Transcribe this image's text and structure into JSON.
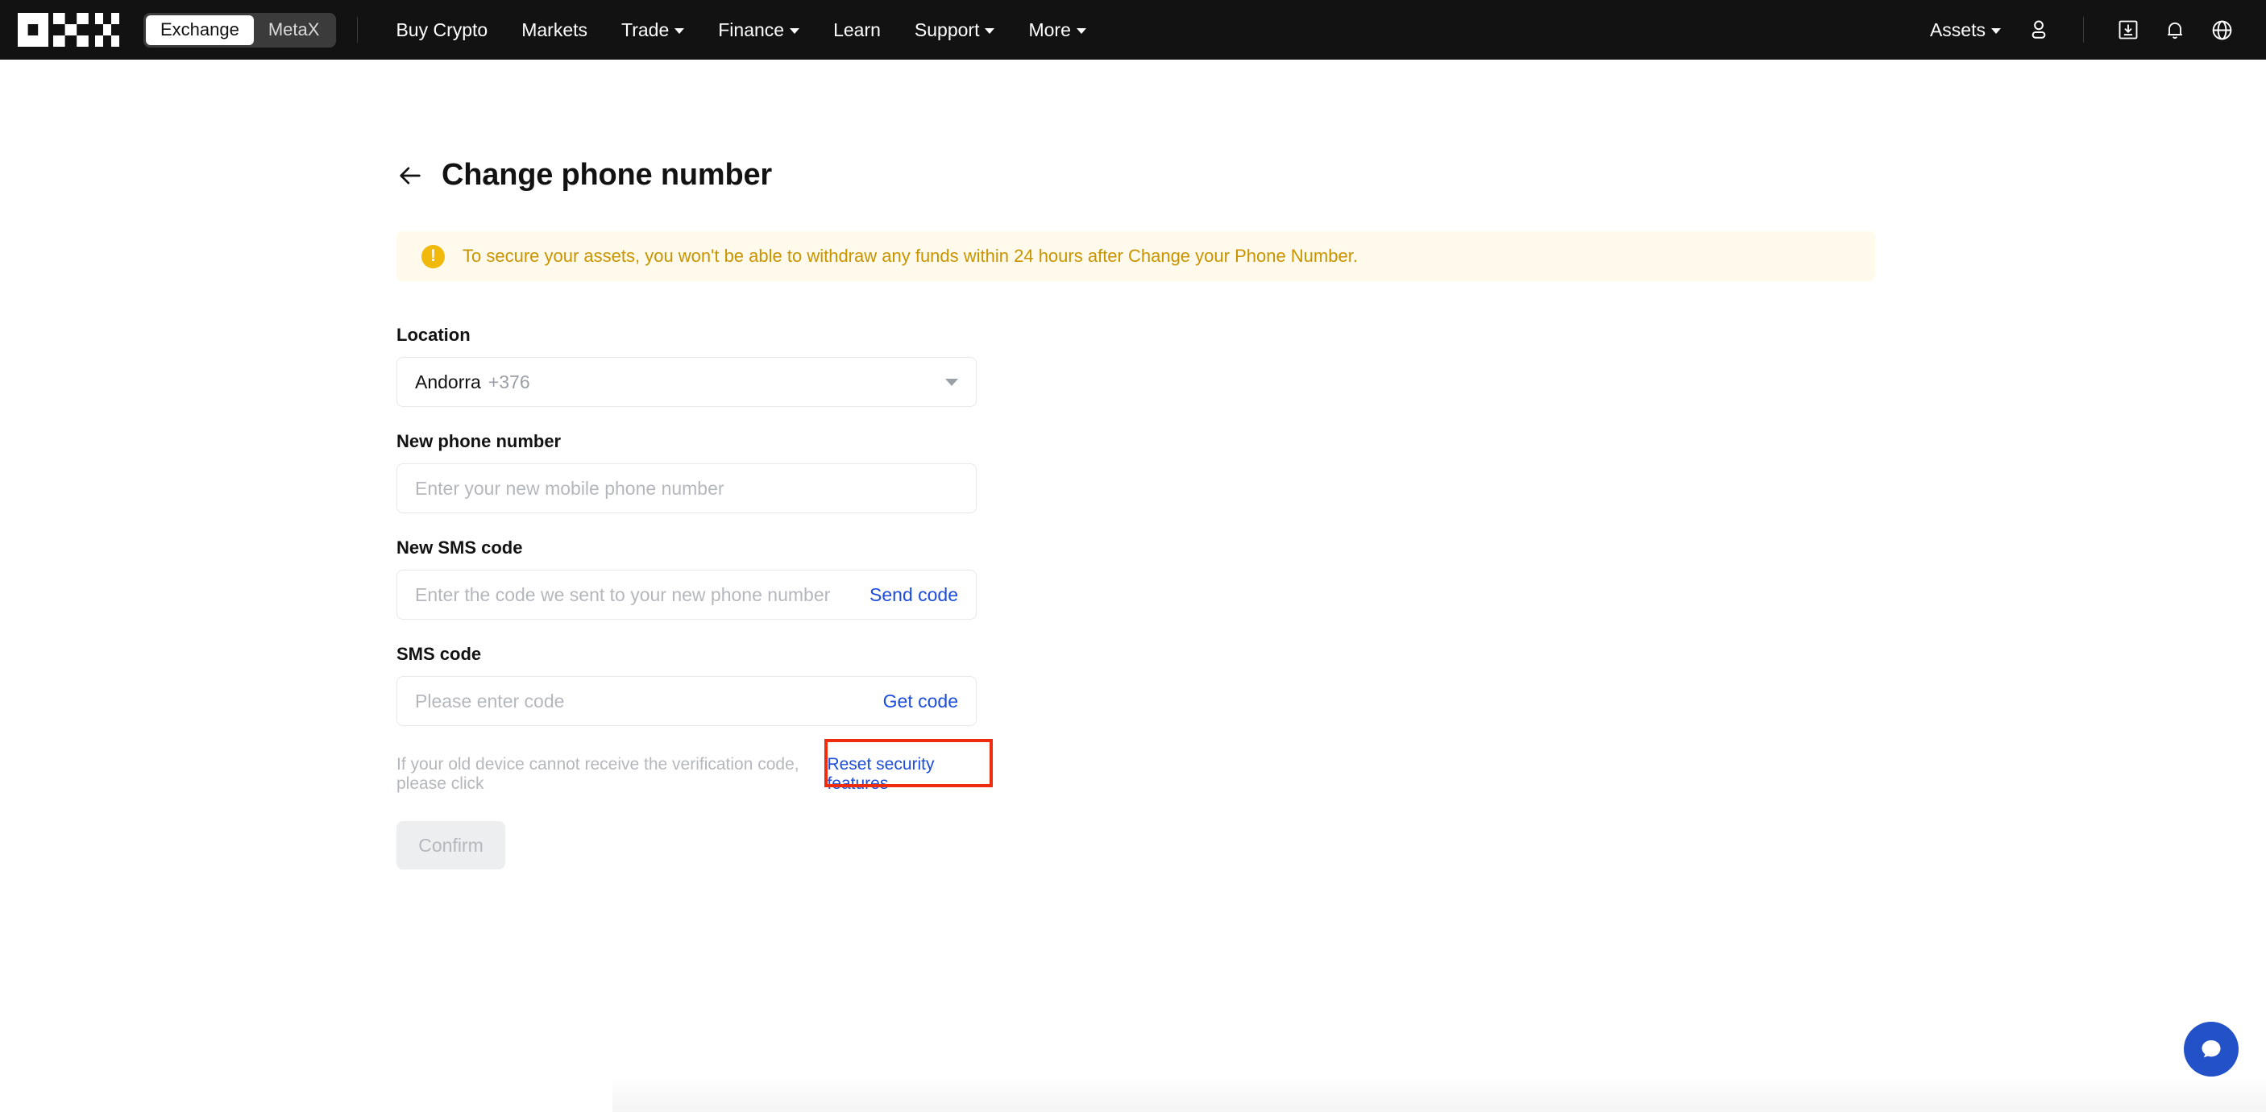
{
  "nav": {
    "logo_alt": "OKX",
    "segments": [
      {
        "label": "Exchange",
        "active": true
      },
      {
        "label": "MetaX",
        "active": false
      }
    ],
    "links": [
      {
        "label": "Buy Crypto",
        "caret": false
      },
      {
        "label": "Markets",
        "caret": false
      },
      {
        "label": "Trade",
        "caret": true
      },
      {
        "label": "Finance",
        "caret": true
      },
      {
        "label": "Learn",
        "caret": false
      },
      {
        "label": "Support",
        "caret": true
      },
      {
        "label": "More",
        "caret": true
      }
    ],
    "assets_label": "Assets",
    "icons": [
      "user-icon",
      "download-icon",
      "notification-bell-icon",
      "language-globe-icon"
    ]
  },
  "page": {
    "title": "Change phone number",
    "back_icon": "back-arrow-icon"
  },
  "alert": {
    "icon": "warning-exclamation-icon",
    "symbol": "!",
    "text": "To secure your assets, you won't be able to withdraw any funds within 24 hours after Change your Phone Number.",
    "background": "#fffaeb",
    "text_color": "#c99400",
    "icon_color": "#f0b90b"
  },
  "form": {
    "location": {
      "label": "Location",
      "country": "Andorra",
      "dial_code": "+376",
      "chevron": "chevron-down-icon"
    },
    "new_phone": {
      "label": "New phone number",
      "value": "",
      "placeholder": "Enter your new mobile phone number"
    },
    "new_sms_code": {
      "label": "New SMS code",
      "value": "",
      "placeholder": "Enter the code we sent to your new phone number",
      "action_label": "Send code"
    },
    "sms_code": {
      "label": "SMS code",
      "value": "",
      "placeholder": "Please enter code",
      "action_label": "Get code"
    },
    "hint": {
      "text": "If your old device cannot receive the verification code, please click",
      "link_label": "Reset security features",
      "highlight_color": "#ee2d0f"
    },
    "confirm_label": "Confirm",
    "link_color": "#1c4ddb"
  },
  "chat": {
    "icon": "chat-bubble-icon",
    "color": "#2352c8"
  }
}
